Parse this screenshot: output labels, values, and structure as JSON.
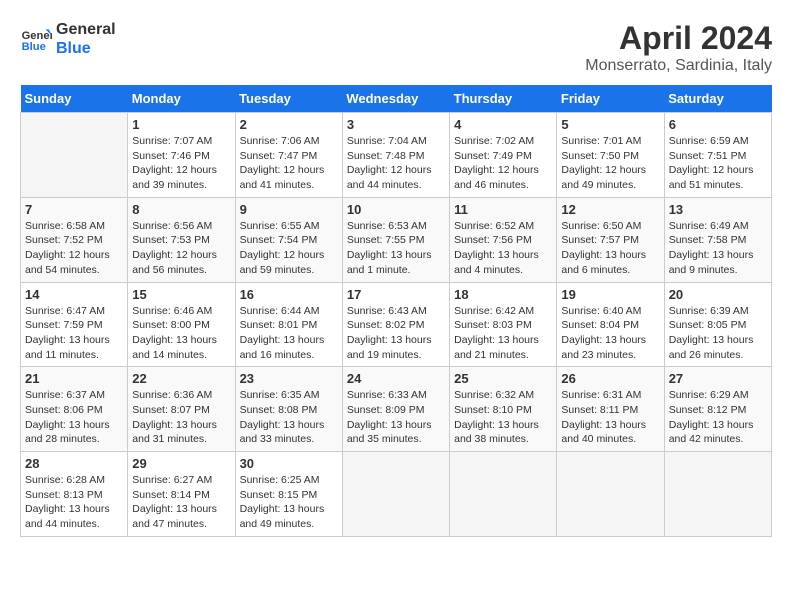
{
  "header": {
    "logo_line1": "General",
    "logo_line2": "Blue",
    "title": "April 2024",
    "location": "Monserrato, Sardinia, Italy"
  },
  "days_of_week": [
    "Sunday",
    "Monday",
    "Tuesday",
    "Wednesday",
    "Thursday",
    "Friday",
    "Saturday"
  ],
  "weeks": [
    [
      {
        "day": "",
        "info": ""
      },
      {
        "day": "1",
        "info": "Sunrise: 7:07 AM\nSunset: 7:46 PM\nDaylight: 12 hours\nand 39 minutes."
      },
      {
        "day": "2",
        "info": "Sunrise: 7:06 AM\nSunset: 7:47 PM\nDaylight: 12 hours\nand 41 minutes."
      },
      {
        "day": "3",
        "info": "Sunrise: 7:04 AM\nSunset: 7:48 PM\nDaylight: 12 hours\nand 44 minutes."
      },
      {
        "day": "4",
        "info": "Sunrise: 7:02 AM\nSunset: 7:49 PM\nDaylight: 12 hours\nand 46 minutes."
      },
      {
        "day": "5",
        "info": "Sunrise: 7:01 AM\nSunset: 7:50 PM\nDaylight: 12 hours\nand 49 minutes."
      },
      {
        "day": "6",
        "info": "Sunrise: 6:59 AM\nSunset: 7:51 PM\nDaylight: 12 hours\nand 51 minutes."
      }
    ],
    [
      {
        "day": "7",
        "info": "Sunrise: 6:58 AM\nSunset: 7:52 PM\nDaylight: 12 hours\nand 54 minutes."
      },
      {
        "day": "8",
        "info": "Sunrise: 6:56 AM\nSunset: 7:53 PM\nDaylight: 12 hours\nand 56 minutes."
      },
      {
        "day": "9",
        "info": "Sunrise: 6:55 AM\nSunset: 7:54 PM\nDaylight: 12 hours\nand 59 minutes."
      },
      {
        "day": "10",
        "info": "Sunrise: 6:53 AM\nSunset: 7:55 PM\nDaylight: 13 hours\nand 1 minute."
      },
      {
        "day": "11",
        "info": "Sunrise: 6:52 AM\nSunset: 7:56 PM\nDaylight: 13 hours\nand 4 minutes."
      },
      {
        "day": "12",
        "info": "Sunrise: 6:50 AM\nSunset: 7:57 PM\nDaylight: 13 hours\nand 6 minutes."
      },
      {
        "day": "13",
        "info": "Sunrise: 6:49 AM\nSunset: 7:58 PM\nDaylight: 13 hours\nand 9 minutes."
      }
    ],
    [
      {
        "day": "14",
        "info": "Sunrise: 6:47 AM\nSunset: 7:59 PM\nDaylight: 13 hours\nand 11 minutes."
      },
      {
        "day": "15",
        "info": "Sunrise: 6:46 AM\nSunset: 8:00 PM\nDaylight: 13 hours\nand 14 minutes."
      },
      {
        "day": "16",
        "info": "Sunrise: 6:44 AM\nSunset: 8:01 PM\nDaylight: 13 hours\nand 16 minutes."
      },
      {
        "day": "17",
        "info": "Sunrise: 6:43 AM\nSunset: 8:02 PM\nDaylight: 13 hours\nand 19 minutes."
      },
      {
        "day": "18",
        "info": "Sunrise: 6:42 AM\nSunset: 8:03 PM\nDaylight: 13 hours\nand 21 minutes."
      },
      {
        "day": "19",
        "info": "Sunrise: 6:40 AM\nSunset: 8:04 PM\nDaylight: 13 hours\nand 23 minutes."
      },
      {
        "day": "20",
        "info": "Sunrise: 6:39 AM\nSunset: 8:05 PM\nDaylight: 13 hours\nand 26 minutes."
      }
    ],
    [
      {
        "day": "21",
        "info": "Sunrise: 6:37 AM\nSunset: 8:06 PM\nDaylight: 13 hours\nand 28 minutes."
      },
      {
        "day": "22",
        "info": "Sunrise: 6:36 AM\nSunset: 8:07 PM\nDaylight: 13 hours\nand 31 minutes."
      },
      {
        "day": "23",
        "info": "Sunrise: 6:35 AM\nSunset: 8:08 PM\nDaylight: 13 hours\nand 33 minutes."
      },
      {
        "day": "24",
        "info": "Sunrise: 6:33 AM\nSunset: 8:09 PM\nDaylight: 13 hours\nand 35 minutes."
      },
      {
        "day": "25",
        "info": "Sunrise: 6:32 AM\nSunset: 8:10 PM\nDaylight: 13 hours\nand 38 minutes."
      },
      {
        "day": "26",
        "info": "Sunrise: 6:31 AM\nSunset: 8:11 PM\nDaylight: 13 hours\nand 40 minutes."
      },
      {
        "day": "27",
        "info": "Sunrise: 6:29 AM\nSunset: 8:12 PM\nDaylight: 13 hours\nand 42 minutes."
      }
    ],
    [
      {
        "day": "28",
        "info": "Sunrise: 6:28 AM\nSunset: 8:13 PM\nDaylight: 13 hours\nand 44 minutes."
      },
      {
        "day": "29",
        "info": "Sunrise: 6:27 AM\nSunset: 8:14 PM\nDaylight: 13 hours\nand 47 minutes."
      },
      {
        "day": "30",
        "info": "Sunrise: 6:25 AM\nSunset: 8:15 PM\nDaylight: 13 hours\nand 49 minutes."
      },
      {
        "day": "",
        "info": ""
      },
      {
        "day": "",
        "info": ""
      },
      {
        "day": "",
        "info": ""
      },
      {
        "day": "",
        "info": ""
      }
    ]
  ]
}
